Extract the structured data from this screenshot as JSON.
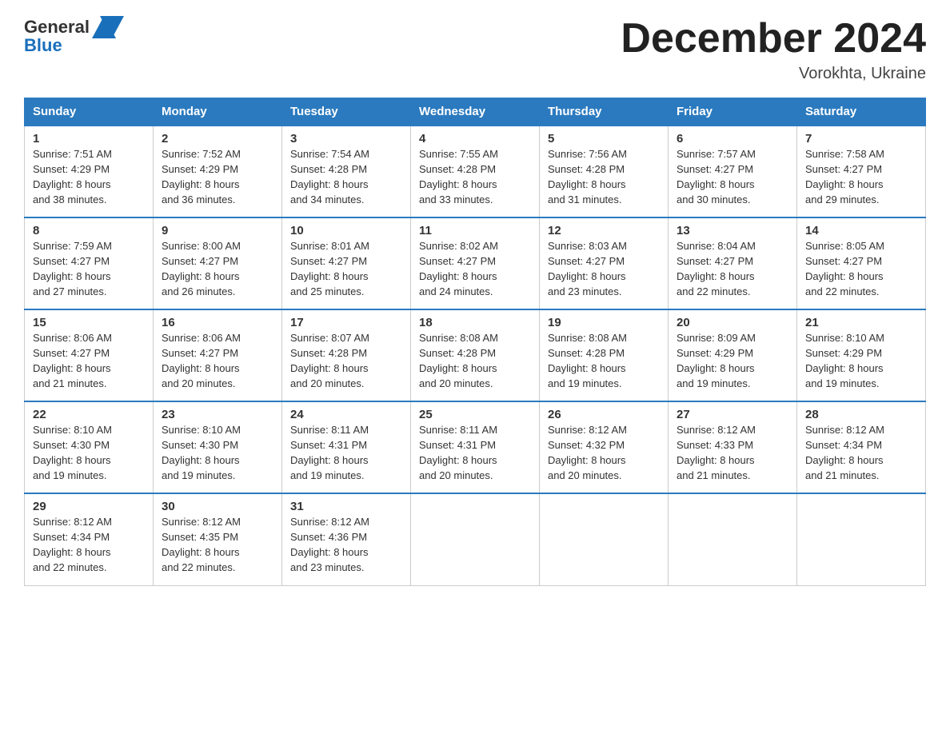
{
  "header": {
    "month_title": "December 2024",
    "location": "Vorokhta, Ukraine",
    "logo_general": "General",
    "logo_blue": "Blue"
  },
  "weekdays": [
    "Sunday",
    "Monday",
    "Tuesday",
    "Wednesday",
    "Thursday",
    "Friday",
    "Saturday"
  ],
  "weeks": [
    [
      {
        "day": "1",
        "sunrise": "7:51 AM",
        "sunset": "4:29 PM",
        "daylight": "8 hours and 38 minutes."
      },
      {
        "day": "2",
        "sunrise": "7:52 AM",
        "sunset": "4:29 PM",
        "daylight": "8 hours and 36 minutes."
      },
      {
        "day": "3",
        "sunrise": "7:54 AM",
        "sunset": "4:28 PM",
        "daylight": "8 hours and 34 minutes."
      },
      {
        "day": "4",
        "sunrise": "7:55 AM",
        "sunset": "4:28 PM",
        "daylight": "8 hours and 33 minutes."
      },
      {
        "day": "5",
        "sunrise": "7:56 AM",
        "sunset": "4:28 PM",
        "daylight": "8 hours and 31 minutes."
      },
      {
        "day": "6",
        "sunrise": "7:57 AM",
        "sunset": "4:27 PM",
        "daylight": "8 hours and 30 minutes."
      },
      {
        "day": "7",
        "sunrise": "7:58 AM",
        "sunset": "4:27 PM",
        "daylight": "8 hours and 29 minutes."
      }
    ],
    [
      {
        "day": "8",
        "sunrise": "7:59 AM",
        "sunset": "4:27 PM",
        "daylight": "8 hours and 27 minutes."
      },
      {
        "day": "9",
        "sunrise": "8:00 AM",
        "sunset": "4:27 PM",
        "daylight": "8 hours and 26 minutes."
      },
      {
        "day": "10",
        "sunrise": "8:01 AM",
        "sunset": "4:27 PM",
        "daylight": "8 hours and 25 minutes."
      },
      {
        "day": "11",
        "sunrise": "8:02 AM",
        "sunset": "4:27 PM",
        "daylight": "8 hours and 24 minutes."
      },
      {
        "day": "12",
        "sunrise": "8:03 AM",
        "sunset": "4:27 PM",
        "daylight": "8 hours and 23 minutes."
      },
      {
        "day": "13",
        "sunrise": "8:04 AM",
        "sunset": "4:27 PM",
        "daylight": "8 hours and 22 minutes."
      },
      {
        "day": "14",
        "sunrise": "8:05 AM",
        "sunset": "4:27 PM",
        "daylight": "8 hours and 22 minutes."
      }
    ],
    [
      {
        "day": "15",
        "sunrise": "8:06 AM",
        "sunset": "4:27 PM",
        "daylight": "8 hours and 21 minutes."
      },
      {
        "day": "16",
        "sunrise": "8:06 AM",
        "sunset": "4:27 PM",
        "daylight": "8 hours and 20 minutes."
      },
      {
        "day": "17",
        "sunrise": "8:07 AM",
        "sunset": "4:28 PM",
        "daylight": "8 hours and 20 minutes."
      },
      {
        "day": "18",
        "sunrise": "8:08 AM",
        "sunset": "4:28 PM",
        "daylight": "8 hours and 20 minutes."
      },
      {
        "day": "19",
        "sunrise": "8:08 AM",
        "sunset": "4:28 PM",
        "daylight": "8 hours and 19 minutes."
      },
      {
        "day": "20",
        "sunrise": "8:09 AM",
        "sunset": "4:29 PM",
        "daylight": "8 hours and 19 minutes."
      },
      {
        "day": "21",
        "sunrise": "8:10 AM",
        "sunset": "4:29 PM",
        "daylight": "8 hours and 19 minutes."
      }
    ],
    [
      {
        "day": "22",
        "sunrise": "8:10 AM",
        "sunset": "4:30 PM",
        "daylight": "8 hours and 19 minutes."
      },
      {
        "day": "23",
        "sunrise": "8:10 AM",
        "sunset": "4:30 PM",
        "daylight": "8 hours and 19 minutes."
      },
      {
        "day": "24",
        "sunrise": "8:11 AM",
        "sunset": "4:31 PM",
        "daylight": "8 hours and 19 minutes."
      },
      {
        "day": "25",
        "sunrise": "8:11 AM",
        "sunset": "4:31 PM",
        "daylight": "8 hours and 20 minutes."
      },
      {
        "day": "26",
        "sunrise": "8:12 AM",
        "sunset": "4:32 PM",
        "daylight": "8 hours and 20 minutes."
      },
      {
        "day": "27",
        "sunrise": "8:12 AM",
        "sunset": "4:33 PM",
        "daylight": "8 hours and 21 minutes."
      },
      {
        "day": "28",
        "sunrise": "8:12 AM",
        "sunset": "4:34 PM",
        "daylight": "8 hours and 21 minutes."
      }
    ],
    [
      {
        "day": "29",
        "sunrise": "8:12 AM",
        "sunset": "4:34 PM",
        "daylight": "8 hours and 22 minutes."
      },
      {
        "day": "30",
        "sunrise": "8:12 AM",
        "sunset": "4:35 PM",
        "daylight": "8 hours and 22 minutes."
      },
      {
        "day": "31",
        "sunrise": "8:12 AM",
        "sunset": "4:36 PM",
        "daylight": "8 hours and 23 minutes."
      },
      null,
      null,
      null,
      null
    ]
  ],
  "labels": {
    "sunrise": "Sunrise:",
    "sunset": "Sunset:",
    "daylight": "Daylight:"
  }
}
